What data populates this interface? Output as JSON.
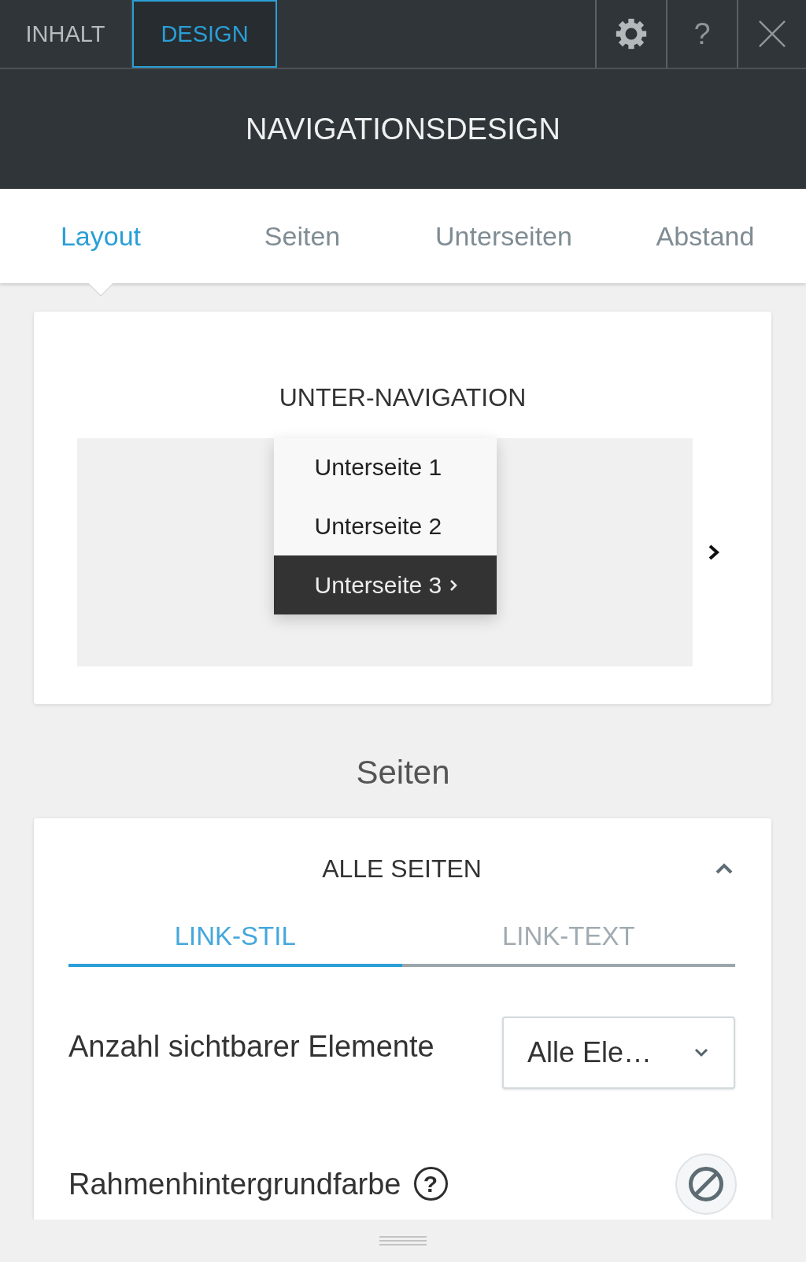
{
  "top_bar": {
    "tabs": [
      {
        "label": "INHALT",
        "selected": false
      },
      {
        "label": "DESIGN",
        "selected": true
      }
    ],
    "buttons": [
      {
        "kind": "settings"
      },
      {
        "kind": "help",
        "label": "?"
      },
      {
        "kind": "close"
      }
    ]
  },
  "title": "NAVIGATIONSDESIGN",
  "sub_tabs": [
    {
      "label": "Layout",
      "selected": true
    },
    {
      "label": "Seiten",
      "selected": false
    },
    {
      "label": "Unterseiten",
      "selected": false
    },
    {
      "label": "Abstand",
      "selected": false
    }
  ],
  "preview_card": {
    "title": "UNTER-NAVIGATION",
    "menu_items": [
      {
        "label": "Unterseite 1",
        "selected": false,
        "has_submenu": false
      },
      {
        "label": "Unterseite 2",
        "selected": false,
        "has_submenu": false
      },
      {
        "label": "Unterseite 3",
        "selected": true,
        "has_submenu": true
      }
    ]
  },
  "section_heading": "Seiten",
  "section_card": {
    "title": "ALLE SEITEN",
    "expanded": true,
    "tabs": [
      {
        "label": "LINK-STIL",
        "selected": true
      },
      {
        "label": "LINK-TEXT",
        "selected": false
      }
    ],
    "settings": [
      {
        "kind": "select",
        "label": "Anzahl sichtbarer Elemente",
        "value": "Alle Ele…"
      },
      {
        "kind": "color",
        "label": "Rahmenhintergrundfarbe",
        "help": "?"
      }
    ]
  }
}
